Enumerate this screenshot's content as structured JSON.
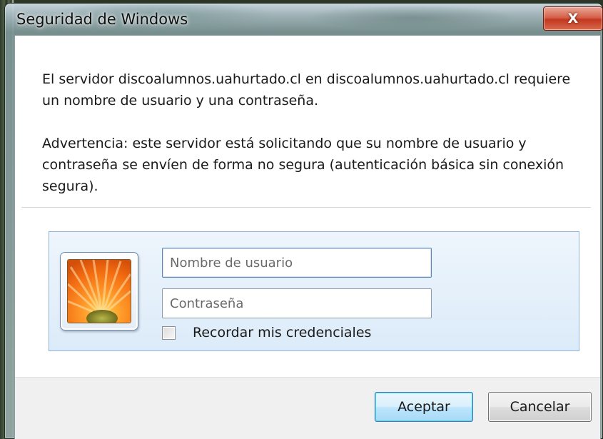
{
  "window": {
    "title": "Seguridad de Windows",
    "close_symbol": "X"
  },
  "message": {
    "line1": "El servidor discoalumnos.uahurtado.cl en discoalumnos.uahurtado.cl requiere un nombre de usuario y una contraseña.",
    "line2": "Advertencia: este servidor está solicitando que su nombre de usuario y contraseña se envíen de forma no segura (autenticación básica sin conexión segura)."
  },
  "credentials": {
    "user_icon": "orange-flower-user-picture",
    "username_placeholder": "Nombre de usuario",
    "username_value": "",
    "password_placeholder": "Contraseña",
    "password_value": "",
    "remember_label": "Recordar mis credenciales",
    "remember_checked": false
  },
  "buttons": {
    "ok_label": "Aceptar",
    "cancel_label": "Cancelar"
  },
  "colors": {
    "panel_border": "#8fb2d6",
    "close_red": "#c1381f",
    "default_button_border": "#3c7fb1"
  }
}
